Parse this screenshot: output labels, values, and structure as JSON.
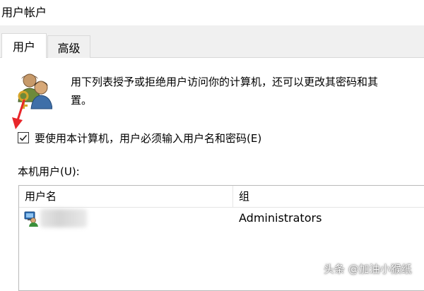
{
  "window": {
    "title": "用户帐户"
  },
  "tabs": [
    {
      "label": "用户",
      "active": true
    },
    {
      "label": "高级",
      "active": false
    }
  ],
  "description": {
    "line1": "用下列表授予或拒绝用户访问你的计算机，还可以更改其密码和其",
    "line2": "置。"
  },
  "require_login": {
    "label": "要使用本计算机，用户必须输入用户名和密码(E)",
    "checked": true
  },
  "local_users": {
    "label": "本机用户(U):",
    "columns": [
      "用户名",
      "组"
    ],
    "rows": [
      {
        "name": "",
        "group": "Administrators"
      }
    ]
  },
  "watermark": "头条 @加油小猴纸",
  "colors": {
    "accent_arrow": "#e8262a",
    "tab_bg": "#f0f0f0",
    "border": "#d9d9d9"
  },
  "icons": {
    "users": "users-key-icon",
    "arrow": "red-arrow-icon",
    "row_user": "user-account-icon"
  }
}
